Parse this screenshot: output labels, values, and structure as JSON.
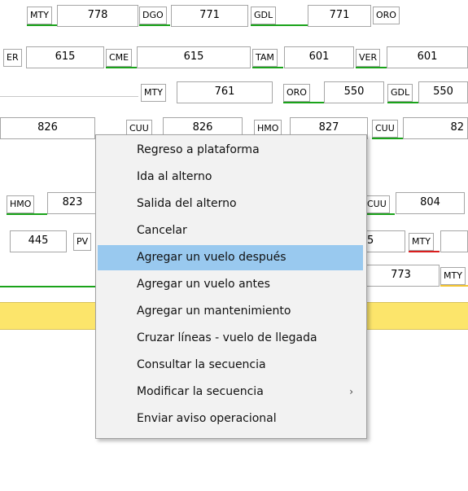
{
  "rows": {
    "r1": {
      "c1": "MTY",
      "v1": "778",
      "c2": "DGO",
      "v2": "771",
      "c3": "GDL",
      "v3": "771",
      "c4": "ORO"
    },
    "r2": {
      "c0": "ER",
      "v0": "615",
      "c1": "CME",
      "v1": "615",
      "c2": "TAM",
      "v2": "601",
      "c3": "VER",
      "v3": "601"
    },
    "r3": {
      "c1": "MTY",
      "v1": "761",
      "c2": "ORO",
      "v2": "550",
      "c3": "GDL",
      "v3": "550"
    },
    "r4": {
      "v0": "826",
      "c1": "CUU",
      "v1": "826",
      "c2": "HMO",
      "v2": "827",
      "c3": "CUU",
      "v3": "82"
    },
    "r5": {
      "c1": "HMO",
      "v1": "823",
      "c2": "CUU",
      "v2": "804"
    },
    "r6": {
      "v0": "445",
      "c1": "PV",
      "v1": "5",
      "c2": "MTY"
    },
    "r7": {
      "v1": "773",
      "c1": "MTY"
    }
  },
  "context_menu": {
    "items": [
      {
        "label": "Regreso a plataforma"
      },
      {
        "label": "Ida al alterno"
      },
      {
        "label": "Salida del alterno"
      },
      {
        "label": "Cancelar"
      },
      {
        "label": "Agregar un vuelo después"
      },
      {
        "label": "Agregar un vuelo antes"
      },
      {
        "label": "Agregar un mantenimiento"
      },
      {
        "label": "Cruzar líneas - vuelo de llegada"
      },
      {
        "label": "Consultar la secuencia"
      },
      {
        "label": "Modificar la secuencia",
        "submenu_icon": "chevron-right-icon"
      },
      {
        "label": "Enviar aviso operacional"
      }
    ],
    "selected_index": 4
  },
  "colors": {
    "on_time": "#1aa31a",
    "delay": "#d91e1e",
    "warning": "#f4c430",
    "highlight_band": "#fce56b",
    "menu_selection": "#99c9ef"
  }
}
